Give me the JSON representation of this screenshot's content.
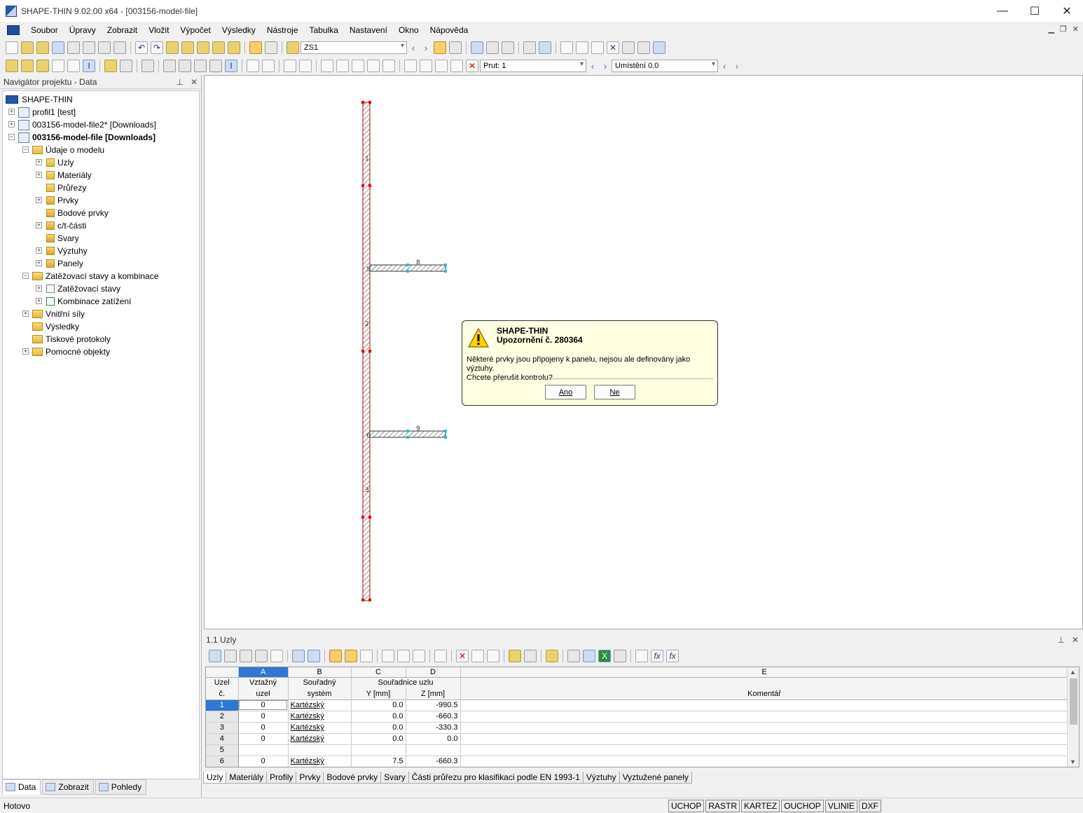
{
  "window": {
    "title": "SHAPE-THIN 9.02.00 x64 - [003156-model-file]",
    "minimize": "—",
    "maximize": "☐",
    "close": "✕"
  },
  "menu": [
    "Soubor",
    "Úpravy",
    "Zobrazit",
    "Vložit",
    "Výpočet",
    "Výsledky",
    "Nástroje",
    "Tabulka",
    "Nastavení",
    "Okno",
    "Nápověda"
  ],
  "toolbar": {
    "load_case": "ZS1",
    "member": "Prut: 1",
    "location": "Umístění 0.0"
  },
  "navigator": {
    "title": "Navigátor projektu - Data",
    "root": "SHAPE-THIN",
    "projects": [
      "profil1 [test]",
      "003156-model-file2* [Downloads]",
      "003156-model-file [Downloads]"
    ],
    "items": {
      "model_data": "Údaje o modelu",
      "nodes": "Uzly",
      "materials": "Materiály",
      "sections": "Průřezy",
      "elements": "Prvky",
      "point_elements": "Bodové prvky",
      "ct_parts": "c/t-části",
      "welds": "Svary",
      "stiffeners": "Výztuhy",
      "panels": "Panely",
      "load_cases_combos": "Zatěžovací stavy a kombinace",
      "load_cases": "Zatěžovací stavy",
      "load_combos": "Kombinace zatížení",
      "internal_forces": "Vnitřní síly",
      "results": "Výsledky",
      "printouts": "Tiskové protokoly",
      "guide_objects": "Pomocné objekty"
    },
    "tabs": [
      "Data",
      "Zobrazit",
      "Pohledy"
    ]
  },
  "canvas": {
    "member_labels": [
      "1",
      "2",
      "3"
    ],
    "node_labels": [
      "5",
      "6"
    ],
    "plate_labels": [
      "8",
      "9"
    ]
  },
  "dialog": {
    "app": "SHAPE-THIN",
    "heading": "Upozornění č. 280364",
    "line1": "Některé prvky jsou připojeny k panelu, nejsou ale definovány jako výztuhy.",
    "line2": "Chcete přerušit kontrolu?",
    "yes": "Ano",
    "no": "Ne"
  },
  "table": {
    "title": "1.1 Uzly",
    "col_letters": [
      "A",
      "B",
      "C",
      "D",
      "E"
    ],
    "headers": {
      "node_no_1": "Uzel",
      "node_no_2": "č.",
      "ref_node_1": "Vztažný",
      "ref_node_2": "uzel",
      "coord_sys_1": "Souřadný",
      "coord_sys_2": "systém",
      "coords": "Souřadnice uzlu",
      "y": "Y [mm]",
      "z": "Z [mm]",
      "comment": "Komentář"
    },
    "rows": [
      {
        "no": "1",
        "ref": "0",
        "sys": "Kartézský",
        "y": "0.0",
        "z": "-990.5"
      },
      {
        "no": "2",
        "ref": "0",
        "sys": "Kartézský",
        "y": "0.0",
        "z": "-660.3"
      },
      {
        "no": "3",
        "ref": "0",
        "sys": "Kartézský",
        "y": "0.0",
        "z": "-330.3"
      },
      {
        "no": "4",
        "ref": "0",
        "sys": "Kartézský",
        "y": "0.0",
        "z": "0.0"
      },
      {
        "no": "5",
        "ref": "",
        "sys": "",
        "y": "",
        "z": ""
      },
      {
        "no": "6",
        "ref": "0",
        "sys": "Kartézský",
        "y": "7.5",
        "z": "-660.3"
      }
    ],
    "tabs": [
      "Uzly",
      "Materiály",
      "Profily",
      "Prvky",
      "Bodové prvky",
      "Svary",
      "Části průřezu pro klasifikaci podle EN 1993-1",
      "Výztuhy",
      "Vyztužené panely"
    ]
  },
  "status": {
    "text": "Hotovo",
    "buttons": [
      "UCHOP",
      "RASTR",
      "KARTEZ",
      "OUCHOP",
      "VLINIE",
      "DXF"
    ]
  }
}
